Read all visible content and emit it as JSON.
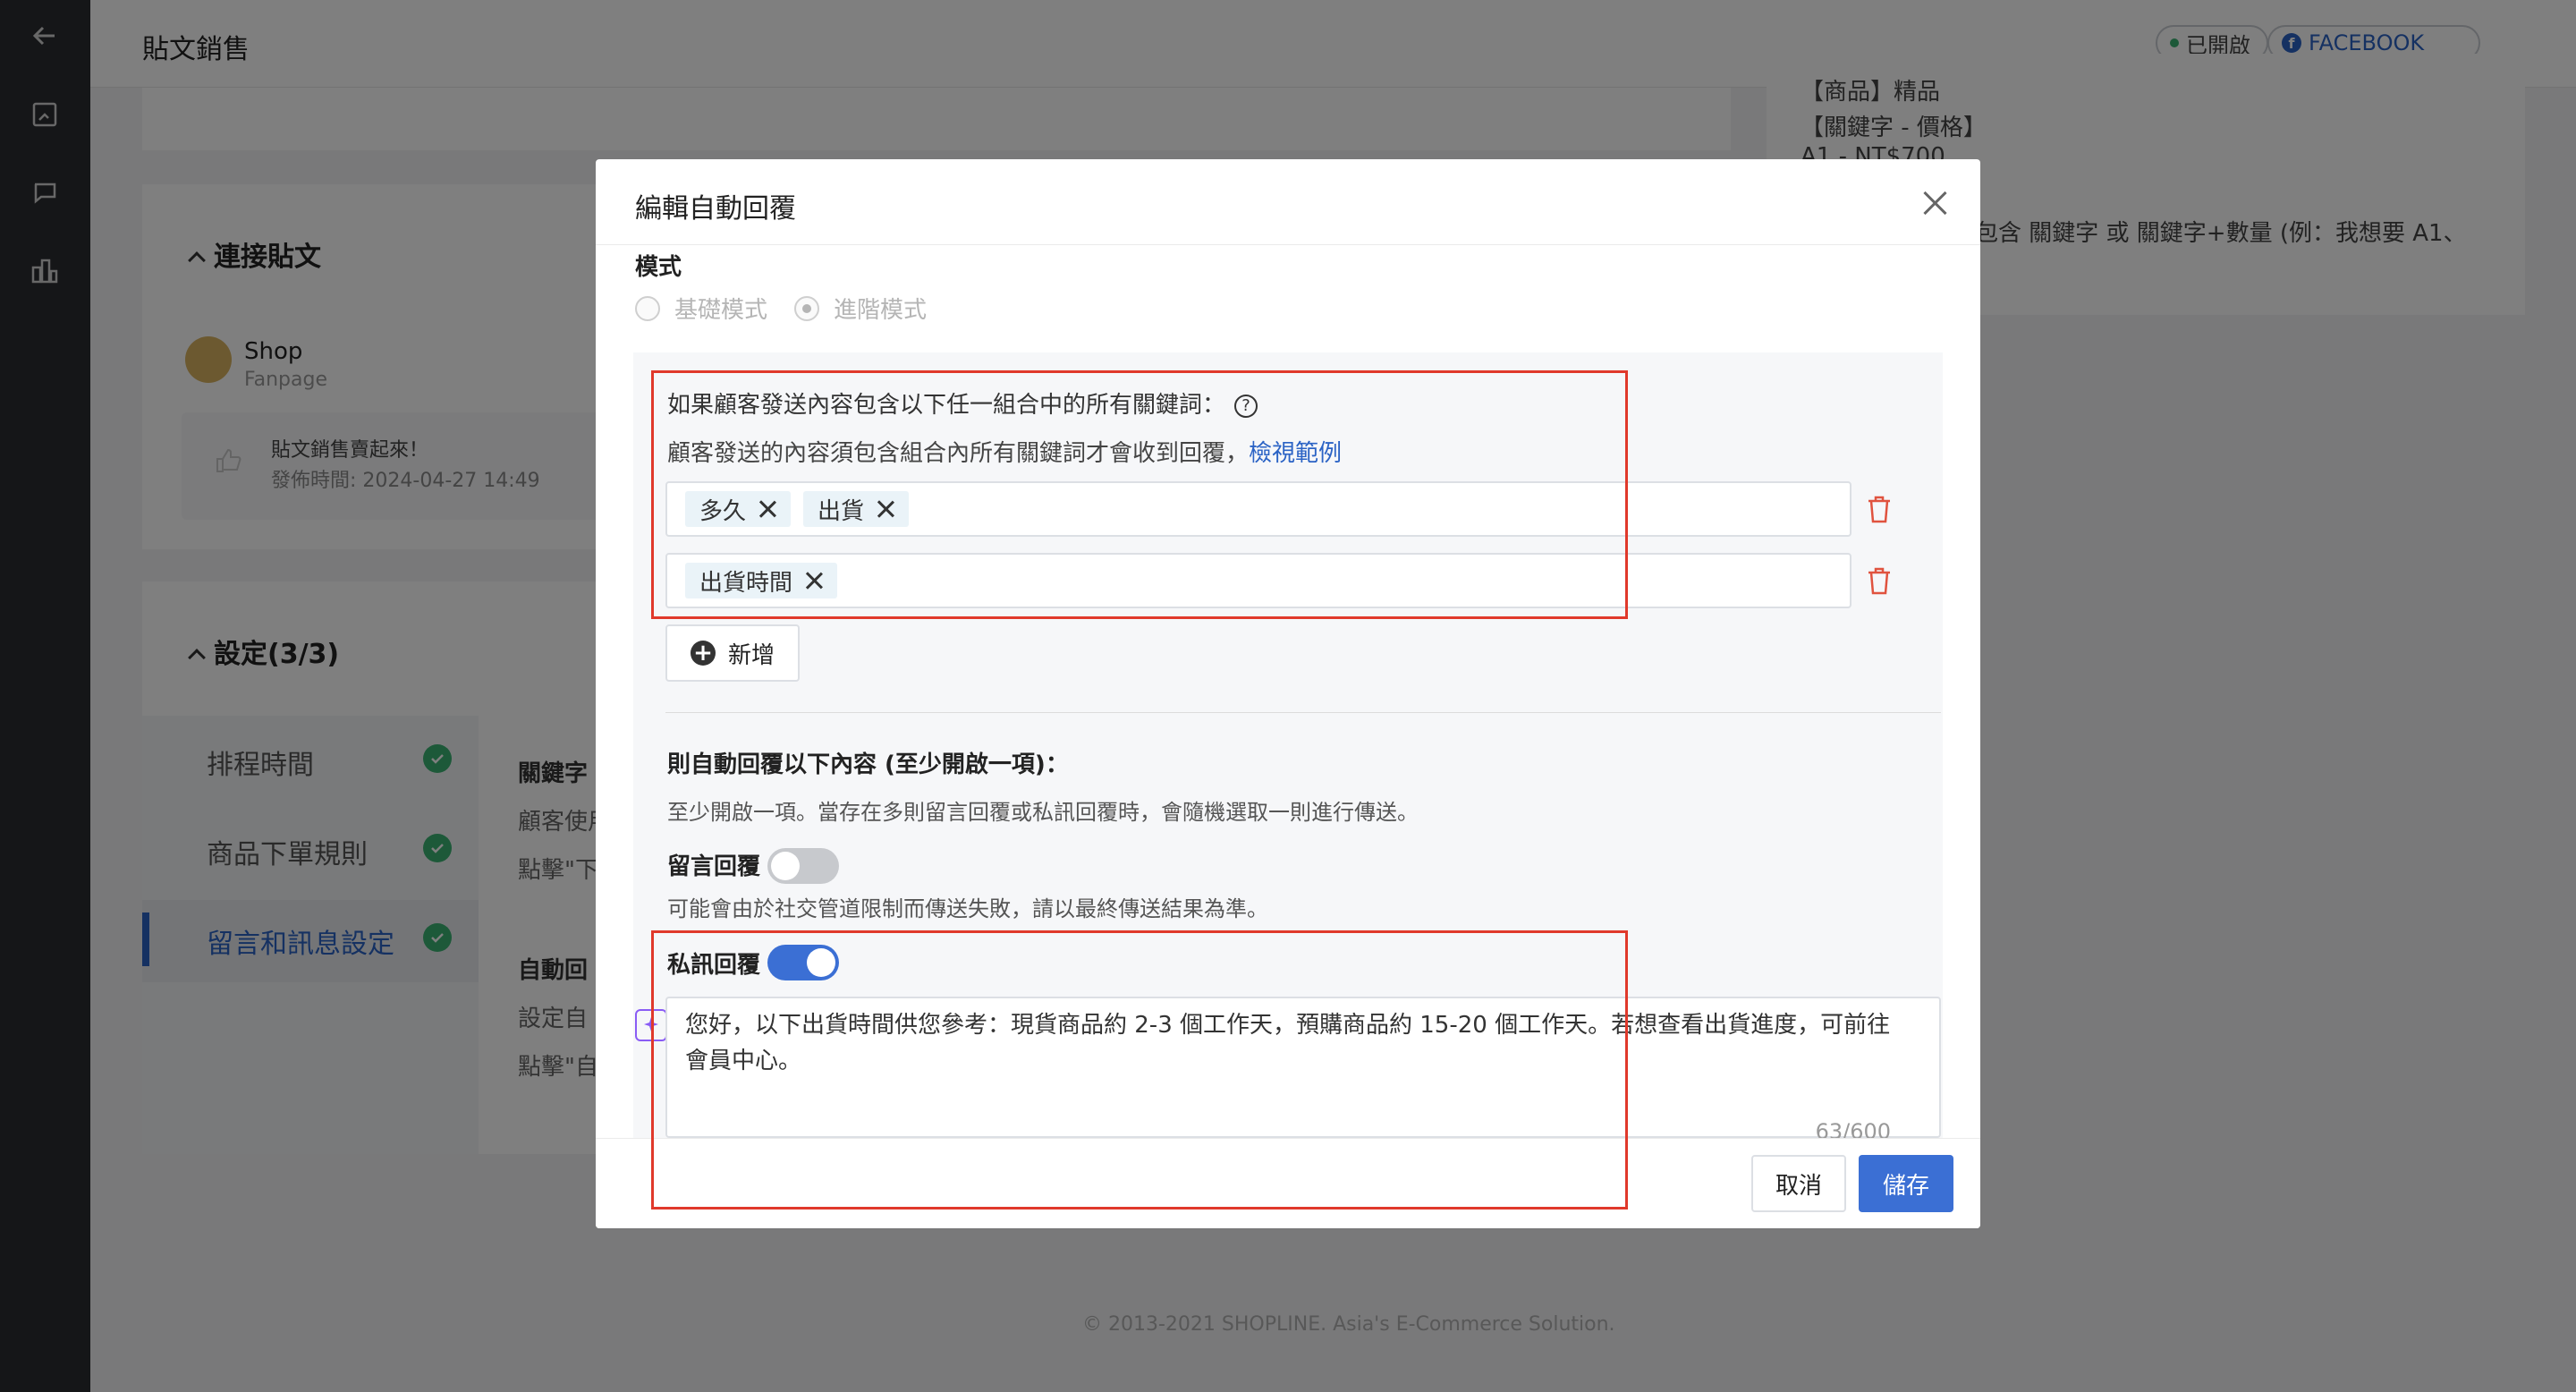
{
  "header": {
    "title": "貼文銷售",
    "status_badge": "已開啟",
    "platform_badge": "FACEBOOK"
  },
  "connect": {
    "title": "連接貼文",
    "shop_name": "Shop",
    "shop_type": "Fanpage",
    "post_title": "貼文銷售賣起來！",
    "post_time": "發佈時間: 2024-04-27 14:49"
  },
  "settings": {
    "title": "設定(3/3)",
    "steps": [
      {
        "label": "排程時間"
      },
      {
        "label": "商品下單規則"
      },
      {
        "label": "留言和訊息設定"
      }
    ],
    "peek_lines": [
      "關鍵字",
      "顧客使用",
      "點擊\"下",
      "自動回",
      "設定自",
      "點擊\"自"
    ]
  },
  "right_card": {
    "line1": "【商品】精品",
    "line2": "【關鍵字 - 價格】",
    "line3": "A1 - NT$700",
    "line4": "包含 關鍵字 或 關鍵字+數量 (例：我想要 A1、"
  },
  "footer": {
    "copyright": "© 2013-2021 SHOPLINE. Asia's E-Commerce Solution."
  },
  "modal": {
    "title": "編輯自動回覆",
    "mode_label": "模式",
    "mode_basic": "基礎模式",
    "mode_advanced": "進階模式",
    "keyword_hint": "如果顧客發送內容包含以下任一組合中的所有關鍵詞：",
    "keyword_sub": "顧客發送的內容須包含組合內所有關鍵詞才會收到回覆，",
    "keyword_example_link": "檢視範例",
    "keyword_groups": [
      {
        "tags": [
          "多久",
          "出貨"
        ]
      },
      {
        "tags": [
          "出貨時間"
        ]
      }
    ],
    "add_label": "新增",
    "reply_title": "則自動回覆以下內容 (至少開啟一項)：",
    "reply_desc": "至少開啟一項。當存在多則留言回覆或私訊回覆時，會隨機選取一則進行傳送。",
    "comment_reply_label": "留言回覆",
    "comment_reply_on": false,
    "comment_reply_note": "可能會由於社交管道限制而傳送失敗，請以最終傳送結果為準。",
    "dm_reply_label": "私訊回覆",
    "dm_reply_on": true,
    "dm_message": "您好，以下出貨時間供您參考：現貨商品約 2-3 個工作天，預購商品約 15-20 個工作天。若想查看出貨進度，可前往會員中心。",
    "dm_count": "63/600",
    "cancel_label": "取消",
    "save_label": "儲存"
  },
  "colors": {
    "accent": "#3b6fd4",
    "link": "#2b63c5",
    "success": "#3bb272",
    "highlight": "#e0392b",
    "delete": "#e0533f"
  }
}
